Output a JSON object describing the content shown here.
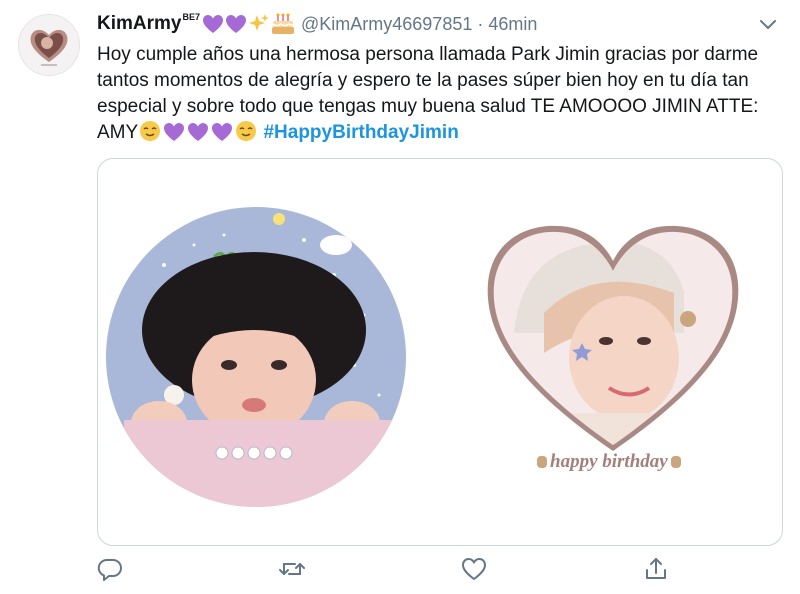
{
  "tweet": {
    "display_name": "KimArmy",
    "name_suffix": "BE7",
    "handle": "@KimArmy46697851",
    "separator": "·",
    "time": "46min",
    "text_main": "Hoy cumple años una hermosa persona llamada Park Jimin gracias por darme tantos momentos de alegría y espero te la pases súper bien hoy en tu día tan especial y sobre todo que tengas muy buena salud TE AMOOOO JIMIN ATTE: AMY",
    "hashtag": "#HappyBirthdayJimin"
  },
  "media": {
    "right_caption": "happy  birthday",
    "baby_letters": "B A B I E"
  },
  "icons": {
    "more": "chevron-down-icon",
    "reply": "reply-icon",
    "retweet": "retweet-icon",
    "like": "like-icon",
    "share": "share-icon"
  },
  "colors": {
    "hashtag": "#1b95e0",
    "secondary_text": "#657786",
    "icon": "#657786",
    "purple_heart": "#a56ad6",
    "border": "#ccd6dd"
  }
}
